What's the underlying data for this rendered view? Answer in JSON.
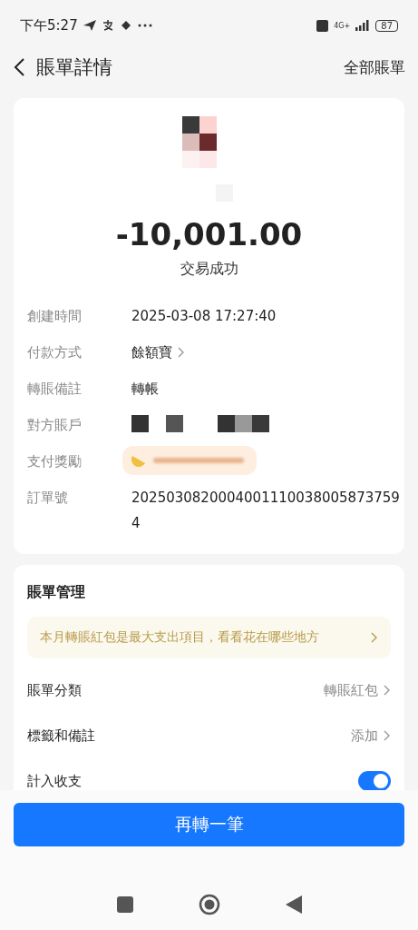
{
  "status_bar": {
    "time": "下午5:27",
    "network": "4G+",
    "battery": "87"
  },
  "header": {
    "title": "賬單詳情",
    "action": "全部賬單"
  },
  "summary": {
    "amount": "-10,001.00",
    "status": "交易成功"
  },
  "details": [
    {
      "kind": "text",
      "label": "創建時間",
      "value": "2025-03-08 17:27:40"
    },
    {
      "kind": "link",
      "label": "付款方式",
      "value": "餘額寶"
    },
    {
      "kind": "text",
      "label": "轉賬備註",
      "value": "轉帳"
    },
    {
      "kind": "redacted",
      "label": "對方賬戶"
    },
    {
      "kind": "reward",
      "label": "支付獎勵"
    },
    {
      "kind": "text",
      "label": "訂單號",
      "value": "2025030820004001110038005873759\n4"
    }
  ],
  "management": {
    "title": "賬單管理",
    "tip": "本月轉賬紅包是最大支出項目，看看花在哪些地方",
    "rows": [
      {
        "kind": "link",
        "label": "賬單分類",
        "value": "轉賬紅包"
      },
      {
        "kind": "link",
        "label": "標籤和備註",
        "value": "添加"
      },
      {
        "kind": "toggle",
        "label": "計入收支",
        "on": true
      }
    ]
  },
  "footer": {
    "button": "再轉一筆"
  }
}
